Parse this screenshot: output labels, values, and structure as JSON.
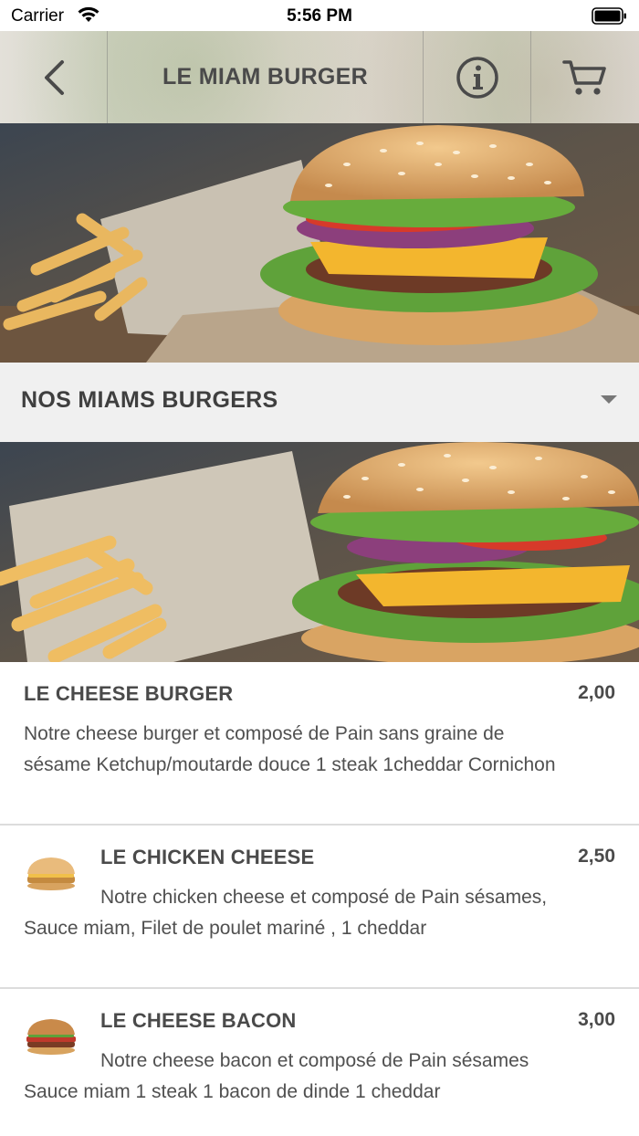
{
  "status_bar": {
    "carrier": "Carrier",
    "time": "5:56 PM"
  },
  "nav": {
    "title": "LE MIAM BURGER",
    "back_icon": "chevron-left-icon",
    "info_icon": "info-icon",
    "cart_icon": "cart-icon"
  },
  "category": {
    "title": "NOS MIAMS BURGERS",
    "expand_icon": "caret-down-icon"
  },
  "items": [
    {
      "name": "LE CHEESE BURGER",
      "price": "2,00",
      "description": "Notre cheese burger et composé de Pain sans graine de sésame Ketchup/moutarde douce 1 steak 1cheddar Cornichon"
    },
    {
      "name": "LE CHICKEN CHEESE",
      "price": "2,50",
      "description": "Notre chicken cheese et composé de Pain sésames, Sauce miam, Filet de poulet mariné , 1 cheddar"
    },
    {
      "name": "LE CHEESE BACON",
      "price": "3,00",
      "description": "Notre cheese bacon et composé de Pain sésames Sauce miam 1 steak 1 bacon de dinde 1 cheddar"
    }
  ],
  "colors": {
    "accent_text": "#4a4a4a",
    "category_bg": "#f0f0f0",
    "divider": "#dcdcdc"
  }
}
